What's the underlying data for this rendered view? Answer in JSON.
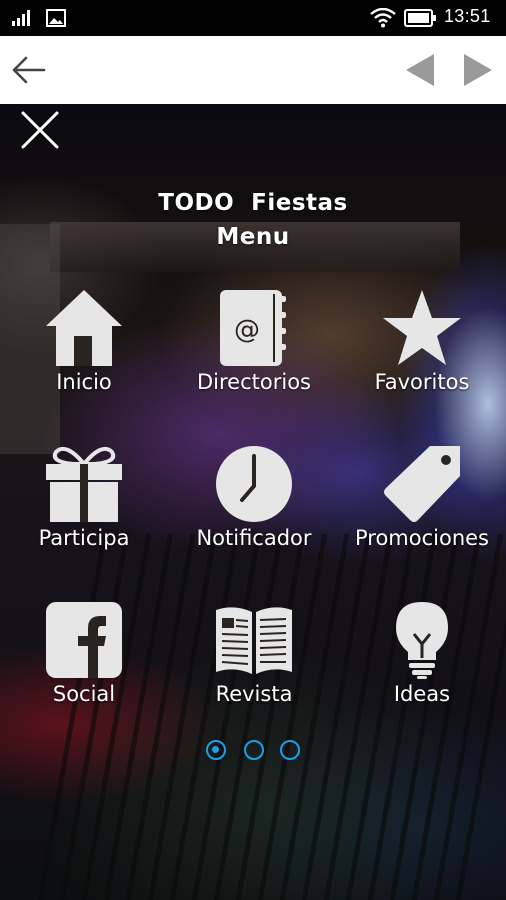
{
  "status_bar": {
    "time": "13:51"
  },
  "toolbar": {},
  "menu": {
    "title_line1": "TODO  Fiestas",
    "title_line2": "Menu",
    "items": [
      {
        "label": "Inicio",
        "icon": "home-icon"
      },
      {
        "label": "Directorios",
        "icon": "address-book-icon"
      },
      {
        "label": "Favoritos",
        "icon": "star-icon"
      },
      {
        "label": "Participa",
        "icon": "gift-icon"
      },
      {
        "label": "Notificador",
        "icon": "clock-icon"
      },
      {
        "label": "Promociones",
        "icon": "tag-icon"
      },
      {
        "label": "Social",
        "icon": "facebook-icon"
      },
      {
        "label": "Revista",
        "icon": "magazine-icon"
      },
      {
        "label": "Ideas",
        "icon": "lightbulb-icon"
      }
    ]
  },
  "pagination": {
    "pages": 3,
    "current": 1
  },
  "colors": {
    "icon": "#e6e6e6",
    "accent": "#1e9ee6",
    "toolbar_bg": "#ffffff",
    "arrow": "#9a9a9a"
  }
}
